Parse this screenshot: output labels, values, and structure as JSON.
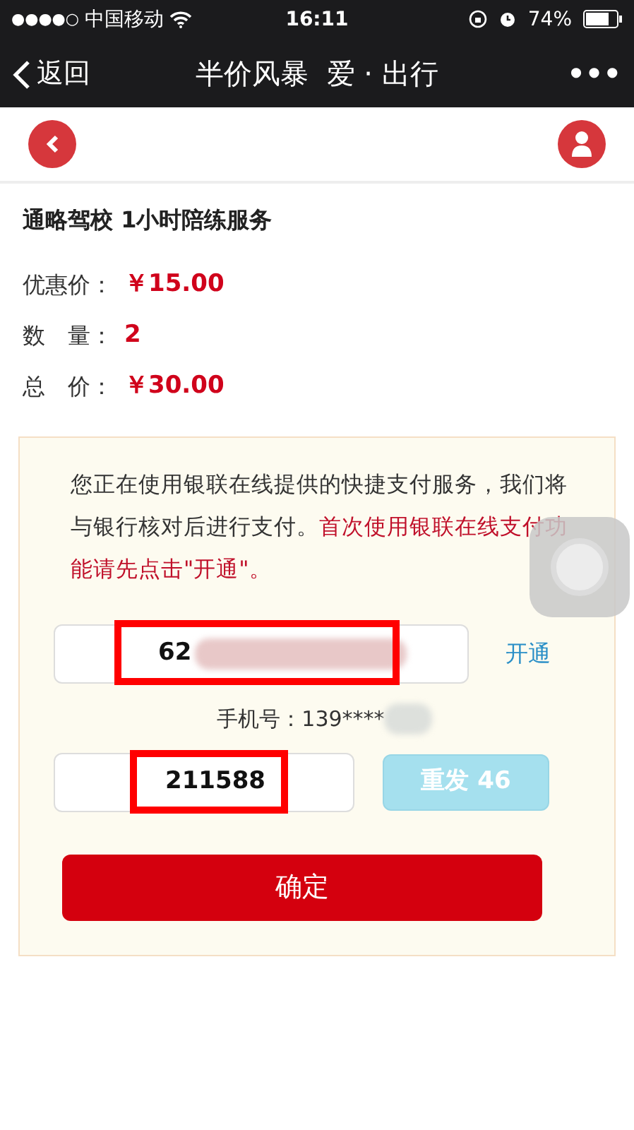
{
  "status_bar": {
    "signal": "●●●●○",
    "carrier": "中国移动",
    "time": "16:11",
    "battery": "74%"
  },
  "nav_bar": {
    "back": "返回",
    "title": "半价风暴  爱 · 出行",
    "more": "•••"
  },
  "order": {
    "title": "通略驾校 1小时陪练服务",
    "rows": [
      {
        "label": "优惠价：",
        "value": "￥15.00"
      },
      {
        "label": "数　量：",
        "value": "2"
      },
      {
        "label": "总　价：",
        "value": "￥30.00"
      }
    ]
  },
  "payment": {
    "notice": "您正在使用银联在线提供的快捷支付服务，我们将与银行核对后进行支付。",
    "notice_highlight": "首次使用银联在线支付功能请先点击\"开通\"。",
    "card_number": "62",
    "open_link": "开通",
    "phone": "手机号：139****",
    "code": "211588",
    "resend": {
      "label": "重发 46",
      "disabled": true
    },
    "confirm": "确定"
  }
}
